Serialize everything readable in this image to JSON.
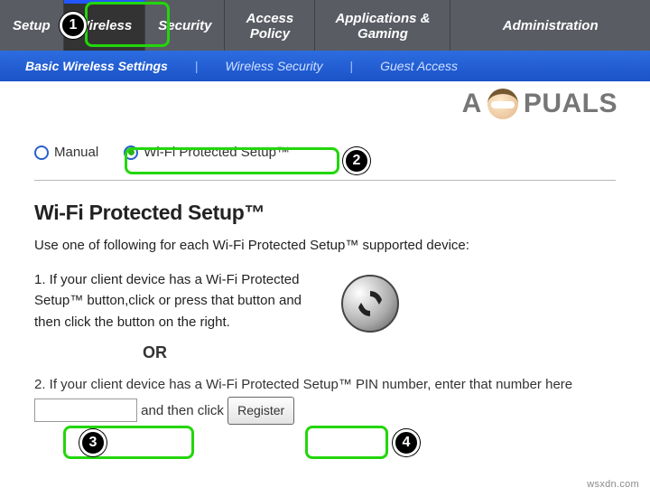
{
  "topnav": {
    "tabs": [
      {
        "label": "Setup"
      },
      {
        "label": "Wireless"
      },
      {
        "label": "Security"
      },
      {
        "label": "Access Policy"
      },
      {
        "label": "Applications & Gaming"
      },
      {
        "label": "Administration"
      }
    ],
    "active_index": 1
  },
  "subnav": {
    "items": [
      "Basic Wireless Settings",
      "Wireless Security",
      "Guest Access"
    ],
    "active_index": 0
  },
  "brand": {
    "first": "A",
    "rest": "PUALS"
  },
  "mode_radio": {
    "manual": "Manual",
    "wps": "Wi-Fi Protected Setup™",
    "selected": "wps"
  },
  "section_title": "Wi-Fi Protected Setup™",
  "intro": "Use one of following for each Wi-Fi Protected Setup™ supported device:",
  "step1": "1. If your client device has a Wi-Fi Protected Setup™ button,click or press that button and then click the button on the right.",
  "or_label": "OR",
  "step2_a": "2. If your client device has a Wi-Fi Protected Setup™ PIN number, enter that number here",
  "step2_b": "and then click",
  "register_label": "Register",
  "callouts": {
    "c1": "1",
    "c2": "2",
    "c3": "3",
    "c4": "4"
  },
  "watermark": "wsxdn.com"
}
